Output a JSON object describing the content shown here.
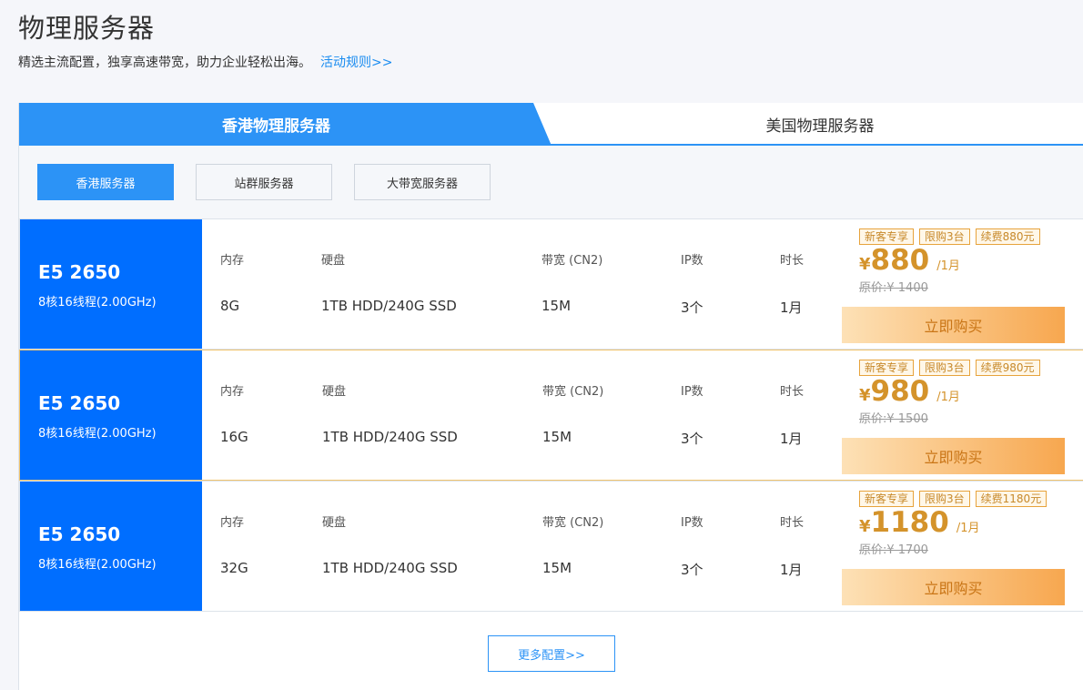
{
  "header": {
    "title": "物理服务器",
    "subtitle": "精选主流配置，独享高速带宽，助力企业轻松出海。",
    "rules_link": "活动规则>>"
  },
  "tabs": [
    {
      "label": "香港物理服务器",
      "active": true
    },
    {
      "label": "美国物理服务器",
      "active": false
    }
  ],
  "subtabs": [
    {
      "label": "香港服务器",
      "active": true
    },
    {
      "label": "站群服务器",
      "active": false
    },
    {
      "label": "大带宽服务器",
      "active": false
    }
  ],
  "columns": {
    "memory": "内存",
    "disk": "硬盘",
    "bandwidth": "带宽 (CN2)",
    "ip": "IP数",
    "duration": "时长"
  },
  "products": [
    {
      "cpu_model": "E5 2650",
      "cpu_spec": "8核16线程(2.00GHz)",
      "memory": "8G",
      "disk": "1TB HDD/240G SSD",
      "bandwidth": "15M",
      "ip": "3个",
      "duration": "1月",
      "badges": [
        "新客专享",
        "限购3台",
        "续费880元"
      ],
      "currency": "¥",
      "price": "880",
      "per": "/1月",
      "original_price": "原价:¥ 1400",
      "buy_label": "立即购买"
    },
    {
      "cpu_model": "E5 2650",
      "cpu_spec": "8核16线程(2.00GHz)",
      "memory": "16G",
      "disk": "1TB HDD/240G SSD",
      "bandwidth": "15M",
      "ip": "3个",
      "duration": "1月",
      "badges": [
        "新客专享",
        "限购3台",
        "续费980元"
      ],
      "currency": "¥",
      "price": "980",
      "per": "/1月",
      "original_price": "原价:¥ 1500",
      "buy_label": "立即购买"
    },
    {
      "cpu_model": "E5 2650",
      "cpu_spec": "8核16线程(2.00GHz)",
      "memory": "32G",
      "disk": "1TB HDD/240G SSD",
      "bandwidth": "15M",
      "ip": "3个",
      "duration": "1月",
      "badges": [
        "新客专享",
        "限购3台",
        "续费1180元"
      ],
      "currency": "¥",
      "price": "1180",
      "per": "/1月",
      "original_price": "原价:¥ 1700",
      "buy_label": "立即购买"
    }
  ],
  "more_label": "更多配置>>",
  "colors": {
    "primary": "#2c93f6",
    "cpu_block": "#006eff",
    "price": "#d4932b",
    "badge_border": "#e7a33c"
  }
}
